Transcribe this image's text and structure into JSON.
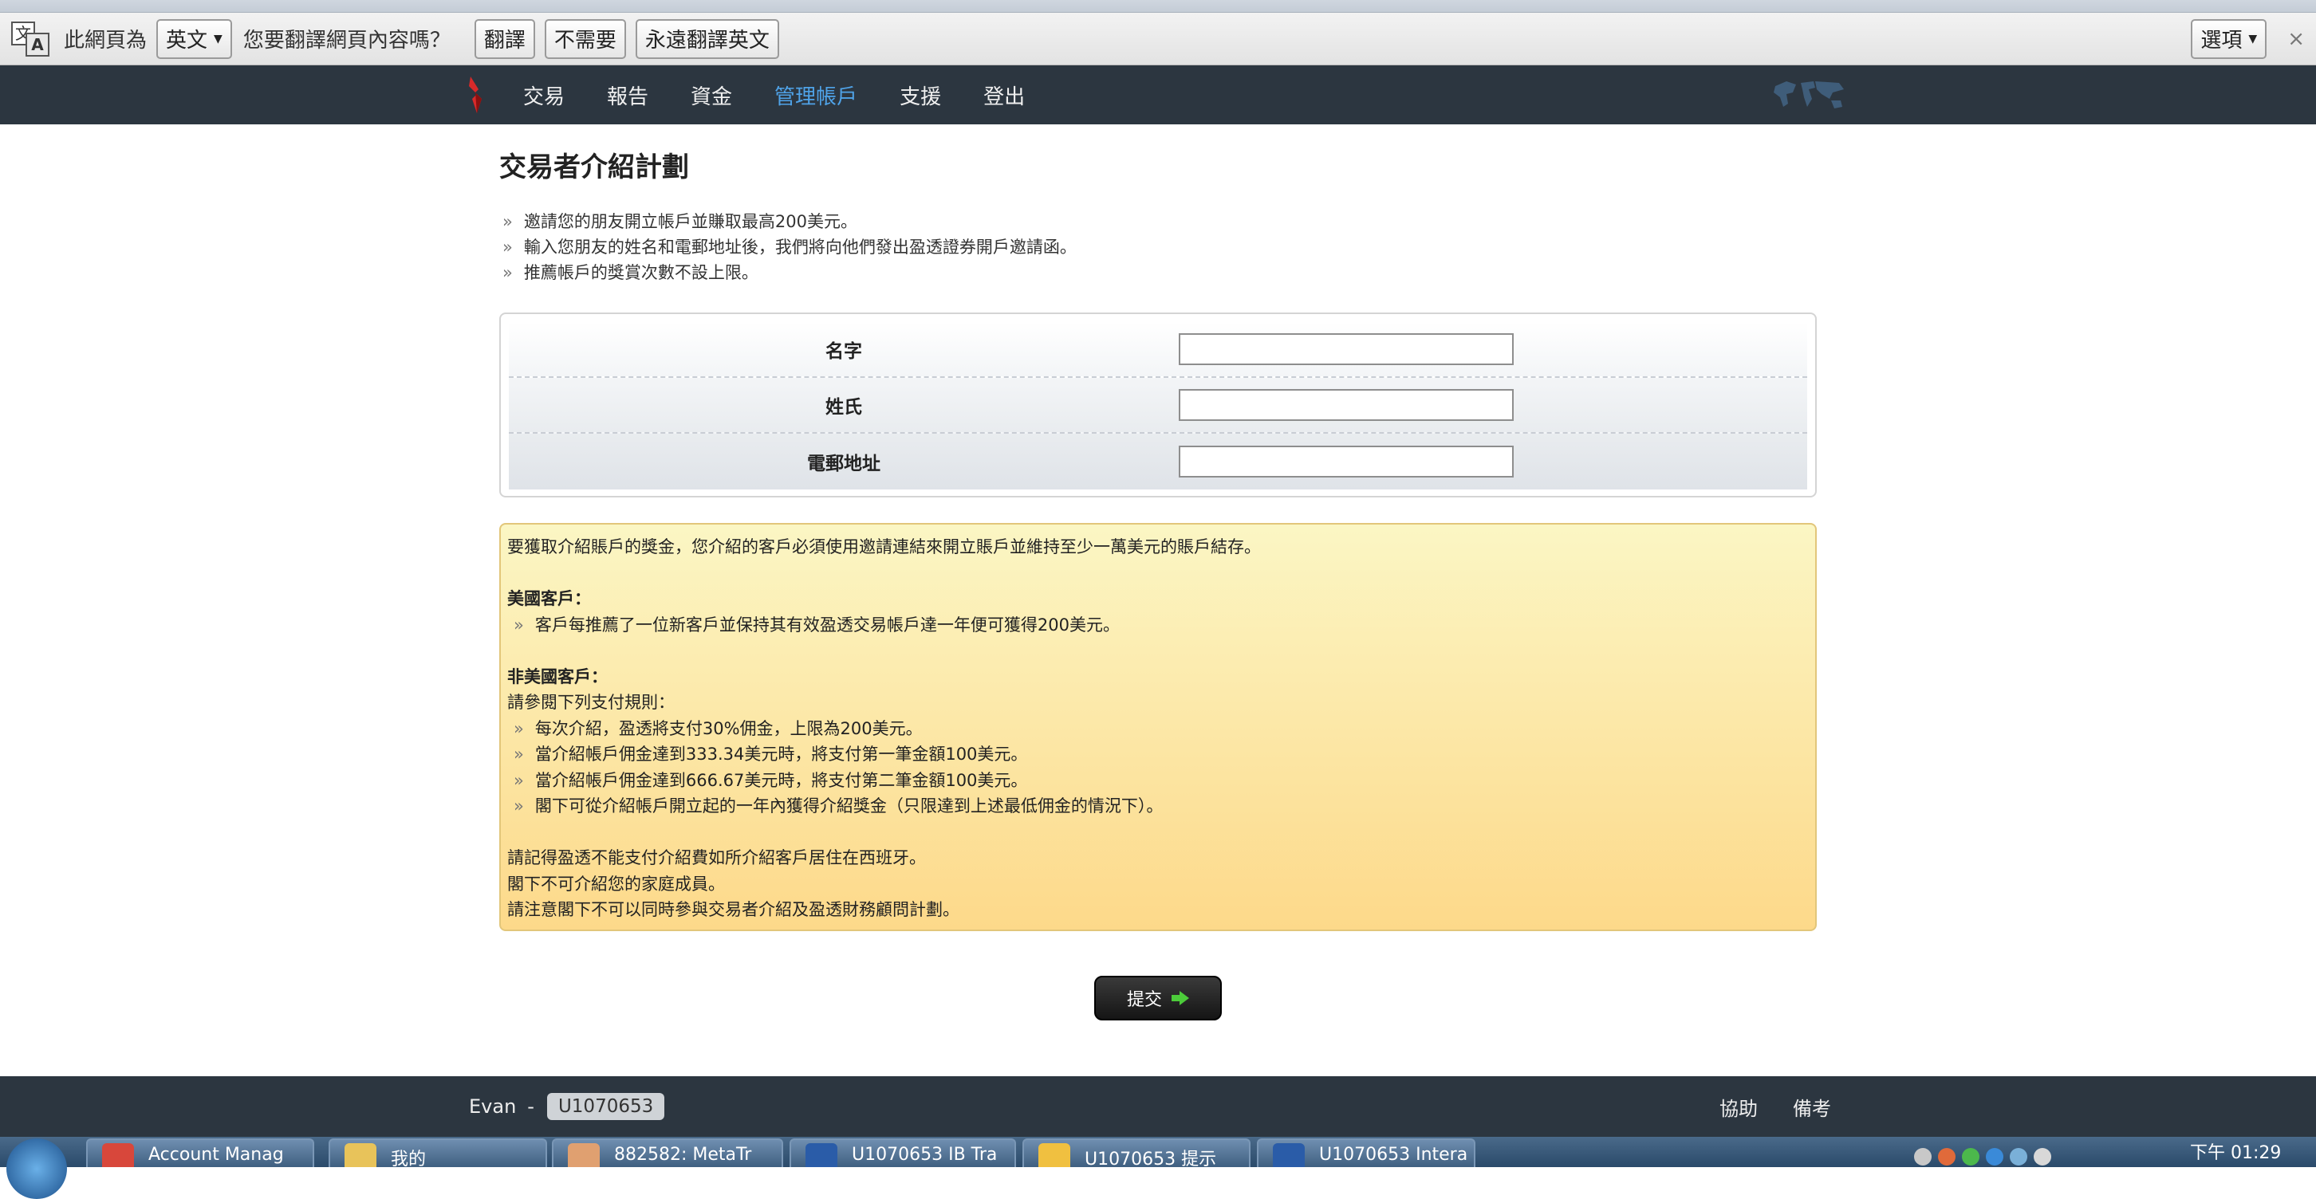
{
  "translate_bar": {
    "prefix": "此網頁為",
    "language": "英文",
    "question": "您要翻譯網頁內容嗎？",
    "translate_label": "翻譯",
    "nope_label": "不需要",
    "always_label": "永遠翻譯英文",
    "options_label": "選項",
    "close_glyph": "×"
  },
  "nav": {
    "items": [
      {
        "label": "交易",
        "active": false
      },
      {
        "label": "報告",
        "active": false
      },
      {
        "label": "資金",
        "active": false
      },
      {
        "label": "管理帳戶",
        "active": true
      },
      {
        "label": "支援",
        "active": false
      },
      {
        "label": "登出",
        "active": false
      }
    ]
  },
  "page": {
    "title": "交易者介紹計劃",
    "bullets": [
      "邀請您的朋友開立帳戶並賺取最高200美元。",
      "輸入您朋友的姓名和電郵地址後，我們將向他們發出盈透證券開戶邀請函。",
      "推薦帳戶的獎賞次數不設上限。"
    ]
  },
  "form": {
    "first_name_label": "名字",
    "last_name_label": "姓氏",
    "email_label": "電郵地址",
    "first_name_value": "",
    "last_name_value": "",
    "email_value": ""
  },
  "notice": {
    "intro": "要獲取介紹賬戶的獎金，您介紹的客戶必須使用邀請連結來開立賬戶並維持至少一萬美元的賬戶結存。",
    "us_heading": "美國客戶：",
    "us_items": [
      "客戶每推薦了一位新客戶並保持其有效盈透交易帳戶達一年便可獲得200美元。"
    ],
    "non_us_heading": "非美國客戶：",
    "non_us_sub": "請參閱下列支付規則：",
    "non_us_items": [
      "每次介紹，盈透將支付30%佣金，上限為200美元。",
      "當介紹帳戶佣金達到333.34美元時，將支付第一筆金額100美元。",
      "當介紹帳戶佣金達到666.67美元時，將支付第二筆金額100美元。",
      "閣下可從介紹帳戶開立起的一年內獲得介紹獎金（只限達到上述最低佣金的情況下）。"
    ],
    "notes": [
      "請記得盈透不能支付介紹費如所介紹客戶居住在西班牙。",
      "閣下不可介紹您的家庭成員。",
      "請注意閣下不可以同時參與交易者介紹及盈透財務顧問計劃。"
    ]
  },
  "submit_label": "提交",
  "footer": {
    "user_name": "Evan",
    "separator": "-",
    "account_id": "U1070653",
    "help_label": "協助",
    "notes_label": "備考"
  },
  "taskbar": {
    "tasks": [
      {
        "label": "Account Manag",
        "color": "#d8473b"
      },
      {
        "label": "我的",
        "color": "#e8c35a"
      },
      {
        "label": "882582: MetaTr",
        "color": "#e0a070"
      },
      {
        "label": "U1070653 IB Tra",
        "color": "#2a5ca8"
      },
      {
        "label": "U1070653 提示",
        "color": "#f0c040"
      },
      {
        "label": "U1070653 Intera",
        "color": "#2a5ca8"
      }
    ],
    "clock": "下午 01:29"
  },
  "colors": {
    "nav_bg": "#2c3640",
    "nav_active": "#4fa3e8",
    "notice_top": "#fbf6c4",
    "notice_bottom": "#fdd98a"
  }
}
